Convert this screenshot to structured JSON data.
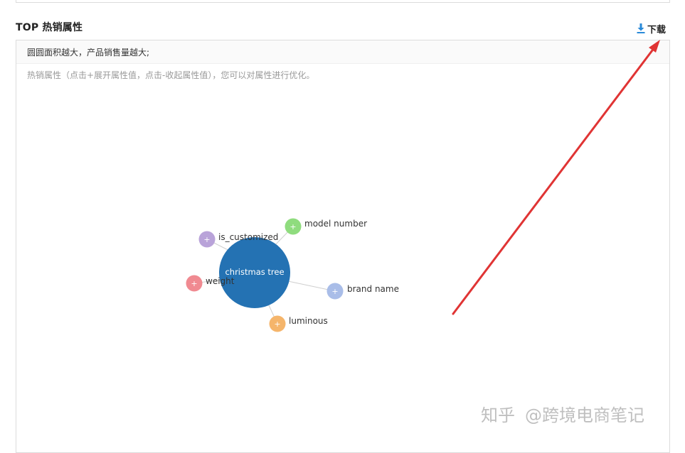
{
  "section": {
    "title": "TOP 热销属性",
    "download_label": "下载"
  },
  "panel": {
    "header_text": "圆圆面积越大，产品销售量越大;",
    "tip_text": "热销属性（点击+展开属性值，点击-收起属性值），您可以对属性进行优化。"
  },
  "graph": {
    "root": {
      "label": "christmas tree",
      "color": "#2472b3"
    },
    "children": [
      {
        "label": "is_customized",
        "color": "#b9a3d9",
        "expand_symbol": "+"
      },
      {
        "label": "model number",
        "color": "#8fdc7e",
        "expand_symbol": "+"
      },
      {
        "label": "weight",
        "color": "#f08a91",
        "expand_symbol": "+"
      },
      {
        "label": "brand name",
        "color": "#a9bde8",
        "expand_symbol": "+"
      },
      {
        "label": "luminous",
        "color": "#f5b56b",
        "expand_symbol": "+"
      }
    ]
  },
  "colors": {
    "arrow": "#e03434",
    "link": "#cfcfcf",
    "download_icon": "#2a8ad8"
  },
  "watermark": {
    "platform": "知乎",
    "author": "@跨境电商笔记"
  }
}
